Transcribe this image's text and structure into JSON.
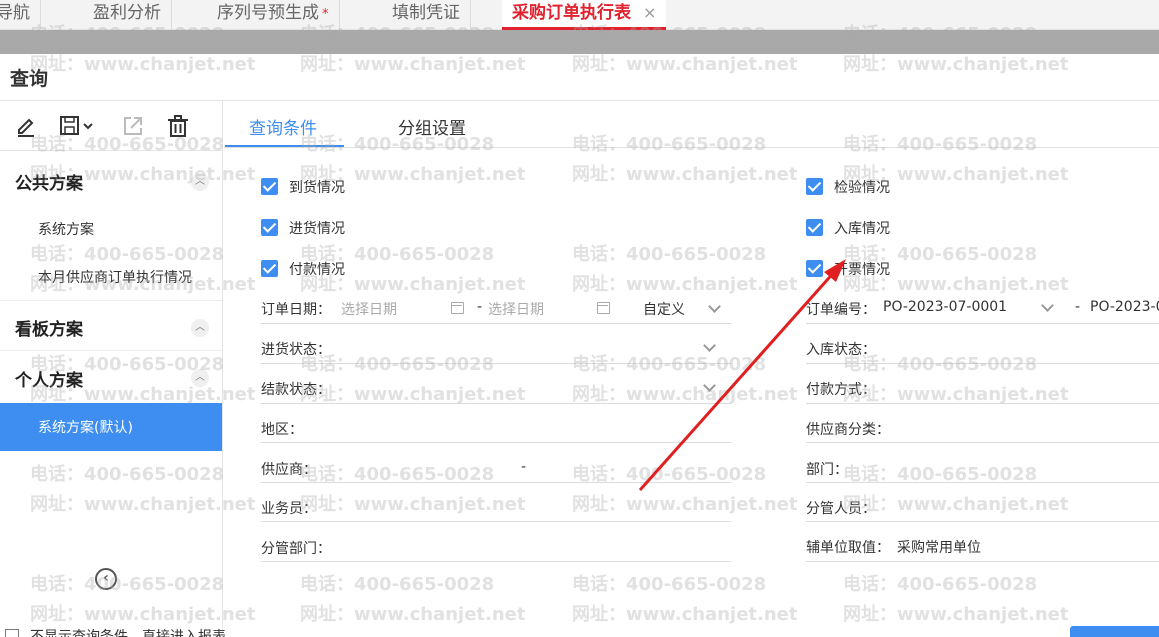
{
  "top_tabs": [
    {
      "label": "导航"
    },
    {
      "label": "盈利分析"
    },
    {
      "label": "序列号预生成",
      "modified_mark": "*"
    },
    {
      "label": "填制凭证"
    },
    {
      "label": "采购订单执行表",
      "close": "×"
    }
  ],
  "page_title": "查询",
  "left": {
    "public_heading": "公共方案",
    "public_items": [
      "系统方案",
      "本月供应商订单执行情况"
    ],
    "board_heading": "看板方案",
    "personal_heading": "个人方案",
    "personal_selected": "系统方案(默认)"
  },
  "main_tabs": [
    "查询条件",
    "分组设置"
  ],
  "checkboxes": {
    "left": [
      "到货情况",
      "进货情况",
      "付款情况"
    ],
    "right": [
      "检验情况",
      "入库情况",
      "开票情况"
    ]
  },
  "form": {
    "order_date_label": "订单日期：",
    "date_placeholder": "选择日期",
    "date_sep": "-",
    "date_mode": "自定义",
    "order_no_label": "订单编号：",
    "order_no_from": "PO-2023-07-0001",
    "order_no_sep": "-",
    "order_no_to": "PO-2023-0",
    "purchase_status_label": "进货状态：",
    "stock_status_label": "入库状态：",
    "settle_status_label": "结款状态：",
    "pay_method_label": "付款方式：",
    "region_label": "地区：",
    "supplier_category_label": "供应商分类：",
    "supplier_label": "供应商：",
    "supplier_sep": "-",
    "department_label": "部门：",
    "salesman_label": "业务员：",
    "manager_label": "分管人员：",
    "managed_dept_label": "分管部门：",
    "aux_unit_label": "辅单位取值：",
    "aux_unit_value": "采购常用单位"
  },
  "footer": {
    "skip_label": "不显示查询条件，直接进入报表"
  },
  "watermark": {
    "phone": "电话：400-665-0028",
    "site": "网址：www.chanjet.net"
  },
  "colors": {
    "accent": "#3d8ef0",
    "active_tab": "#e0222e",
    "arrow": "#e02020"
  },
  "icons": [
    "edit-icon",
    "save-icon",
    "export-icon",
    "delete-icon",
    "collapse-up-icon",
    "collapse-left-icon",
    "calendar-icon",
    "chevron-down-icon"
  ]
}
